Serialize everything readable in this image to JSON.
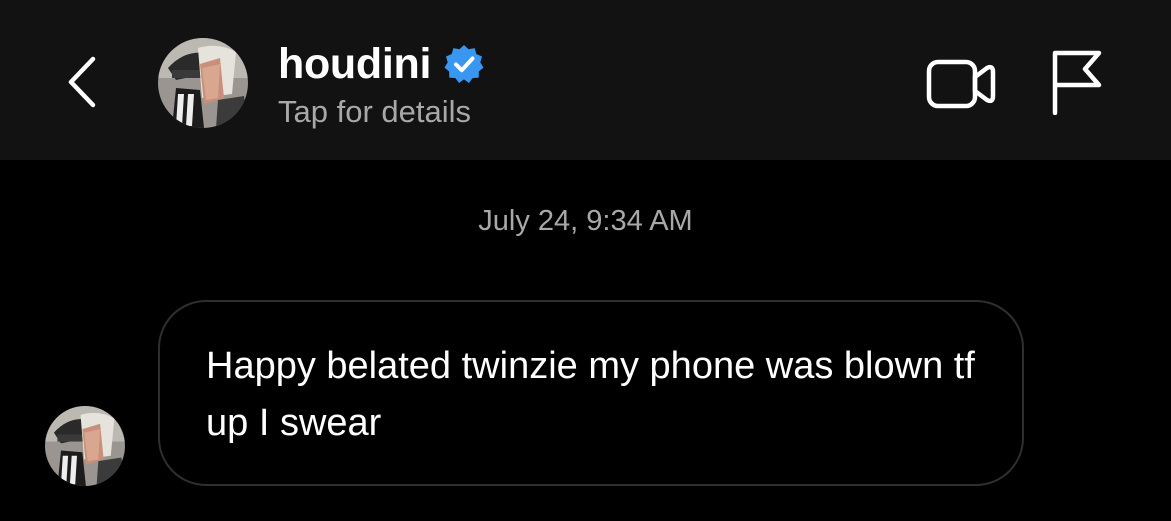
{
  "header": {
    "back_icon": "chevron-left-icon",
    "username": "houdini",
    "verified_icon": "verified-badge-icon",
    "subtitle": "Tap for details",
    "actions": {
      "video_icon": "video-camera-icon",
      "report_icon": "flag-icon"
    }
  },
  "conversation": {
    "timestamp": "July 24, 9:34 AM",
    "messages": [
      {
        "sender": "houdini",
        "text": "Happy belated twinzie my phone was blown tf up I swear"
      }
    ]
  },
  "colors": {
    "background": "#000000",
    "header_background": "#121212",
    "secondary_text": "#a8a8a8",
    "bubble_border": "#2f2f2f",
    "verified_blue": "#3897f0"
  }
}
